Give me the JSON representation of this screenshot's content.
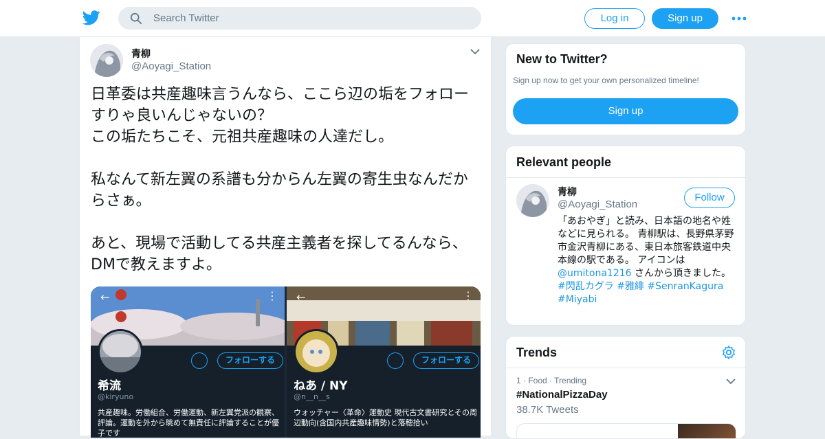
{
  "header": {
    "search_placeholder": "Search Twitter",
    "login_label": "Log in",
    "signup_label": "Sign up",
    "brand_color": "#1da1f2"
  },
  "tweet": {
    "author_name": "青柳",
    "author_handle": "@Aoyagi_Station",
    "text": "日革委は共産趣味言うんなら、ここら辺の垢をフォローすりゃ良いんじゃないの？\nこの垢たちこそ、元祖共産趣味の人達だし。\n\n私なんて新左翼の系譜も分からん左翼の寄生虫なんだからさぁ。\n\nあと、現場で活動してる共産主義者を探してるんなら、DMで教えますよ。",
    "media": [
      {
        "name": "希流",
        "handle": "@kiryuno",
        "follow_label": "フォローする",
        "bio": "共産趣味。労働組合、労働運動、新左翼党派の観察、評論。運動を外から眺めて無責任に評論することが優子です"
      },
      {
        "name": "ねあ / NY",
        "handle": "@n__n__s",
        "follow_label": "フォローする",
        "bio": "ウォッチャー〈革命〉運動史 現代古文書研究とその周辺動向(含国内共産趣味情勢)と落穂拾い"
      }
    ]
  },
  "new_to_twitter": {
    "title": "New to Twitter?",
    "subtitle": "Sign up now to get your own personalized timeline!",
    "signup_label": "Sign up"
  },
  "relevant_people": {
    "title": "Relevant people",
    "name": "青柳",
    "handle": "@Aoyagi_Station",
    "follow_label": "Follow",
    "bio_part1": "「あおやぎ」と読み、日本語の地名や姓などに見られる。 青柳駅は、長野県茅野市金沢青柳にある、東日本旅客鉄道中央本線の駅である。 アイコンは ",
    "bio_mention": "@umitona1216",
    "bio_part2": " さんから頂きました。 ",
    "bio_tag1": "#閃乱カグラ",
    "bio_tag2": "#雅緋",
    "bio_tag3": "#SenranKagura",
    "bio_tag4": "#Miyabi"
  },
  "trends": {
    "title": "Trends",
    "items": [
      {
        "meta": "1 · Food · Trending",
        "name": "#NationalPizzaDay",
        "count": "38.7K Tweets"
      }
    ]
  }
}
